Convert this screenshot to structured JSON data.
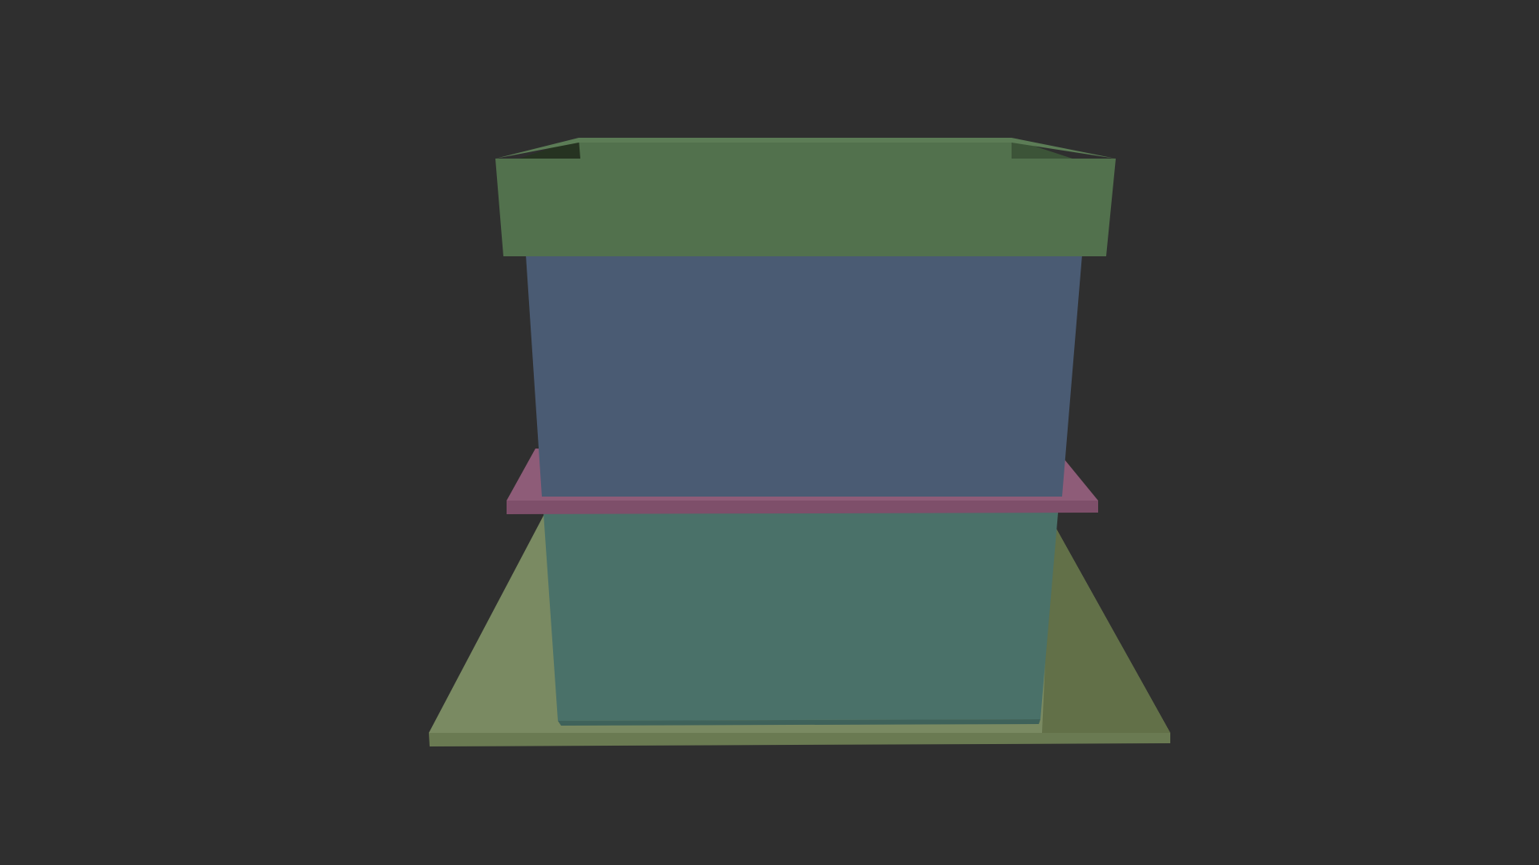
{
  "scene": {
    "background": "#2f2f2f",
    "objects": [
      {
        "name": "base-plate",
        "face": "#7a8a62",
        "side": "#627048",
        "edge": "#6e7d56",
        "front": "#6a7a52"
      },
      {
        "name": "lower-box",
        "face": "#4a7169",
        "side": "#3f625a"
      },
      {
        "name": "divider-plate",
        "face": "#8e5c78",
        "front": "#7e4f6a"
      },
      {
        "name": "upper-box",
        "face": "#4a5b73",
        "side": "#415066"
      },
      {
        "name": "top-rim",
        "face": "#52714d",
        "inner": "#3c5438",
        "shadow": "#263321",
        "top": "#5c7c56"
      }
    ]
  }
}
